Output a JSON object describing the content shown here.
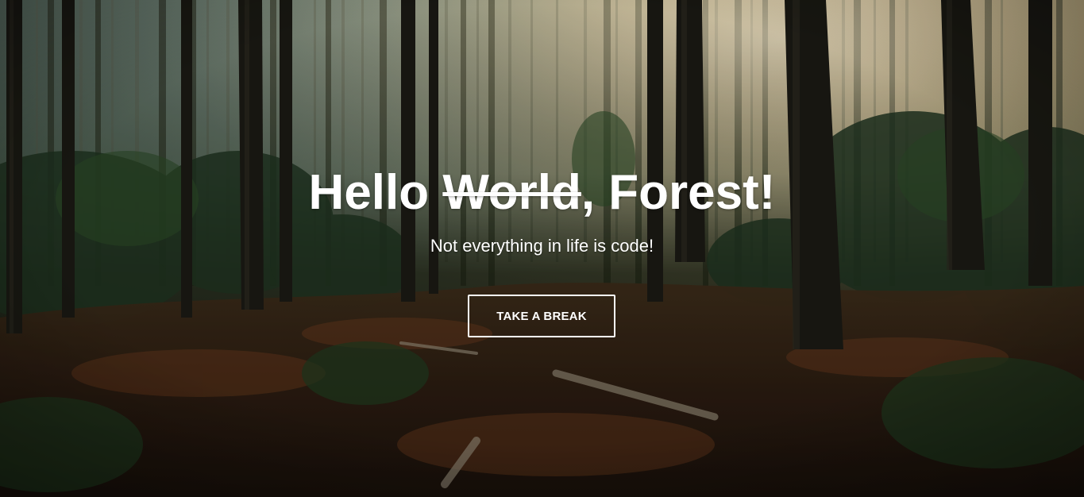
{
  "hero": {
    "title_prefix": "Hello ",
    "title_struck": "World",
    "title_suffix": ", Forest!",
    "subtitle": "Not everything in life is code!",
    "cta_label": "TAKE A BREAK"
  },
  "colors": {
    "text": "#ffffff",
    "button_border": "#ffffff"
  }
}
